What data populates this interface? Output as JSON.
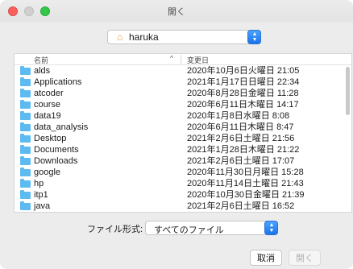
{
  "window": {
    "title": "開く"
  },
  "location": {
    "folder_name": "haruka",
    "icon": "home-icon"
  },
  "list": {
    "columns": {
      "name": "名前",
      "date": "変更日"
    },
    "sort_indicator": "^",
    "rows": [
      {
        "name": "alds",
        "date": "2020年10月6日火曜日 21:05"
      },
      {
        "name": "Applications",
        "date": "2021年1月17日日曜日 22:34"
      },
      {
        "name": "atcoder",
        "date": "2020年8月28日金曜日 11:28"
      },
      {
        "name": "course",
        "date": "2020年6月11日木曜日 14:17"
      },
      {
        "name": "data19",
        "date": "2020年1月8日水曜日 8:08"
      },
      {
        "name": "data_analysis",
        "date": "2020年6月11日木曜日 8:47"
      },
      {
        "name": "Desktop",
        "date": "2021年2月6日土曜日 21:56"
      },
      {
        "name": "Documents",
        "date": "2021年1月28日木曜日 21:22"
      },
      {
        "name": "Downloads",
        "date": "2021年2月6日土曜日 17:07"
      },
      {
        "name": "google",
        "date": "2020年11月30日月曜日 15:28"
      },
      {
        "name": "hp",
        "date": "2020年11月14日土曜日 21:43"
      },
      {
        "name": "itp1",
        "date": "2020年10月30日金曜日 21:39"
      },
      {
        "name": "java",
        "date": "2021年2月6日土曜日 16:52"
      }
    ]
  },
  "file_type": {
    "label": "ファイル形式:",
    "value": "すべてのファイル"
  },
  "buttons": {
    "cancel": "取消",
    "open": "開く"
  },
  "colors": {
    "accent": "#1a73e8",
    "folder": "#5ebbf1"
  }
}
